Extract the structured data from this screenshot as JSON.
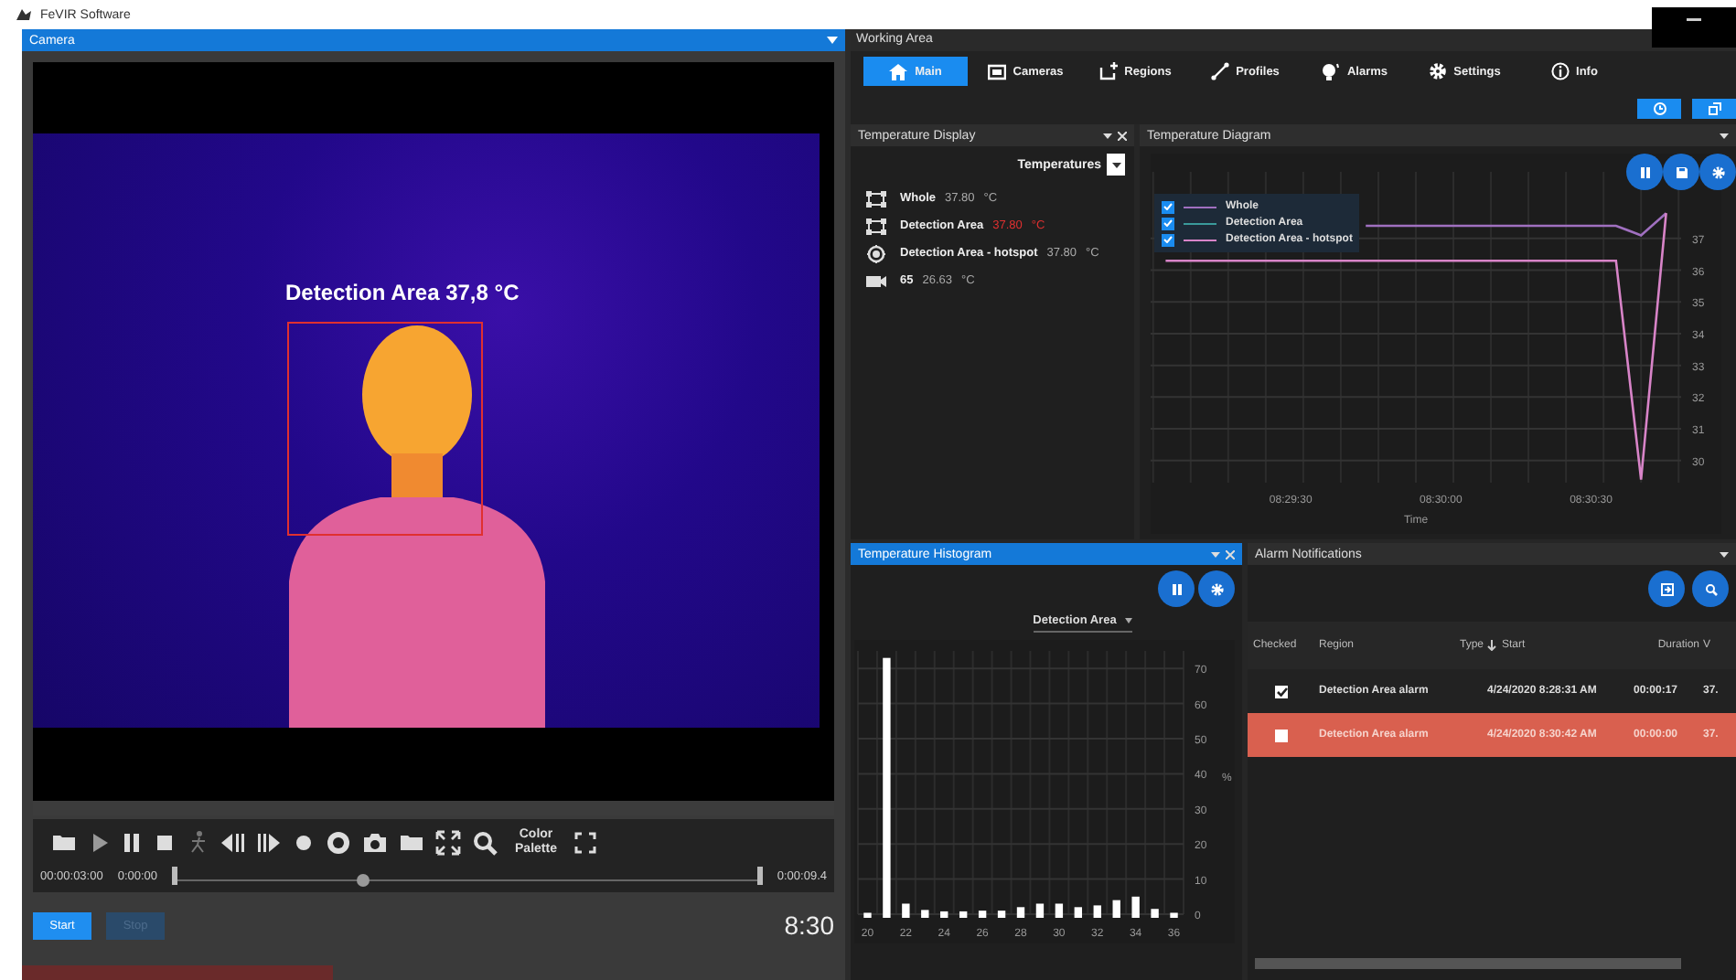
{
  "window": {
    "title": "FeVIR Software"
  },
  "camera": {
    "title": "Camera",
    "overlay_label": "Detection Area 37,8 °C",
    "playback": {
      "color_palette": "Color Palette",
      "position": "00:00:03:00",
      "start_time": "0:00:00",
      "end_time": "0:00:09.4",
      "level": 0.32
    },
    "buttons": [
      {
        "label": "Start",
        "disabled": false
      },
      {
        "label": "Stop",
        "disabled": true
      }
    ],
    "clock": "8:30"
  },
  "working_area": {
    "title": "Working Area",
    "tabs": [
      {
        "label": "Main",
        "selected": true
      },
      {
        "label": "Cameras",
        "selected": false
      },
      {
        "label": "Regions",
        "selected": false
      },
      {
        "label": "Profiles",
        "selected": false
      },
      {
        "label": "Alarms",
        "selected": false
      },
      {
        "label": "Settings",
        "selected": false
      },
      {
        "label": "Info",
        "selected": false
      }
    ]
  },
  "temperature_display": {
    "title": "Temperature Display",
    "selected": false,
    "selector": "Temperatures",
    "items": [
      {
        "kind": "region",
        "name": "Whole",
        "value": "37.80",
        "unit": "°C",
        "alarm": false
      },
      {
        "kind": "region",
        "name": "Detection Area",
        "value": "37.80",
        "unit": "°C",
        "alarm": true
      },
      {
        "kind": "hotspot",
        "name": "Detection Area - hotspot",
        "value": "37.80",
        "unit": "°C",
        "alarm": false
      },
      {
        "kind": "camera",
        "name": "65",
        "value": "26.63",
        "unit": "°C",
        "alarm": false
      }
    ]
  },
  "temperature_diagram": {
    "title": "Temperature Diagram",
    "selected": false,
    "legend": [
      {
        "checked": true
      },
      {
        "checked": true
      },
      {
        "checked": true
      }
    ],
    "chart_data": {
      "type": "line",
      "grid": true,
      "legend": true,
      "xlabel": "Time",
      "categories": [
        null,
        null,
        null,
        null,
        null,
        "08:29:30",
        null,
        null,
        null,
        null,
        null,
        "08:30:00",
        null,
        null,
        null,
        null,
        null,
        "08:30:30",
        null,
        null,
        null
      ],
      "ylim": [
        29.3,
        39.1
      ],
      "yticks": [
        30,
        31,
        32,
        33,
        34,
        35,
        36,
        37
      ],
      "series": [
        {
          "name": "Whole",
          "color": "#a070c0",
          "values": [
            null,
            null,
            null,
            null,
            null,
            null,
            null,
            null,
            37.4,
            37.4,
            37.4,
            37.4,
            37.4,
            37.4,
            37.4,
            37.4,
            37.4,
            37.4,
            37.4,
            37.1,
            37.8
          ]
        },
        {
          "name": "Detection Area",
          "color": "#3a9a9a",
          "values": [
            null,
            null,
            null,
            null,
            null,
            null,
            null,
            null,
            null,
            null,
            null,
            null,
            null,
            null,
            null,
            null,
            null,
            null,
            null,
            null,
            null
          ]
        },
        {
          "name": "Detection Area - hotspot",
          "color": "#d884c8",
          "values": [
            36.3,
            36.3,
            36.3,
            36.3,
            36.3,
            36.3,
            36.3,
            36.3,
            36.3,
            36.3,
            36.3,
            36.3,
            36.3,
            36.3,
            36.3,
            36.3,
            36.3,
            36.3,
            36.3,
            29.4,
            37.8
          ]
        }
      ]
    }
  },
  "temperature_histogram": {
    "title": "Temperature Histogram",
    "selected": true,
    "selector": "Detection Area",
    "chart_data": {
      "type": "bar",
      "ylabel": "%",
      "grid": true,
      "categories": [
        "20",
        null,
        "22",
        null,
        "24",
        null,
        "26",
        null,
        "28",
        null,
        "30",
        null,
        "32",
        null,
        "34",
        null,
        "36"
      ],
      "values": [
        0.2,
        73,
        3,
        1.2,
        0.8,
        0.8,
        1,
        1,
        2,
        3,
        3,
        2,
        2.5,
        4,
        5,
        1.5,
        0.2
      ],
      "ylim": [
        0,
        75
      ],
      "yticks": [
        0,
        10,
        20,
        30,
        40,
        50,
        60,
        70
      ]
    }
  },
  "alarm_notifications": {
    "title": "Alarm Notifications",
    "selected": false,
    "columns": [
      {
        "label": "Checked"
      },
      {
        "label": "Region"
      },
      {
        "label": "Type"
      },
      {
        "label": "Start",
        "sorted": true
      },
      {
        "label": "Duration"
      },
      {
        "label": "V"
      }
    ],
    "rows": [
      {
        "checked": true,
        "highlighted": false,
        "region": "Detection Area alarm",
        "start": "4/24/2020 8:28:31 AM",
        "duration": "00:00:17",
        "column_6": "37."
      },
      {
        "checked": false,
        "highlighted": true,
        "region": "Detection Area alarm",
        "start": "4/24/2020 8:30:42 AM",
        "duration": "00:00:00",
        "column_6": "37."
      }
    ]
  }
}
